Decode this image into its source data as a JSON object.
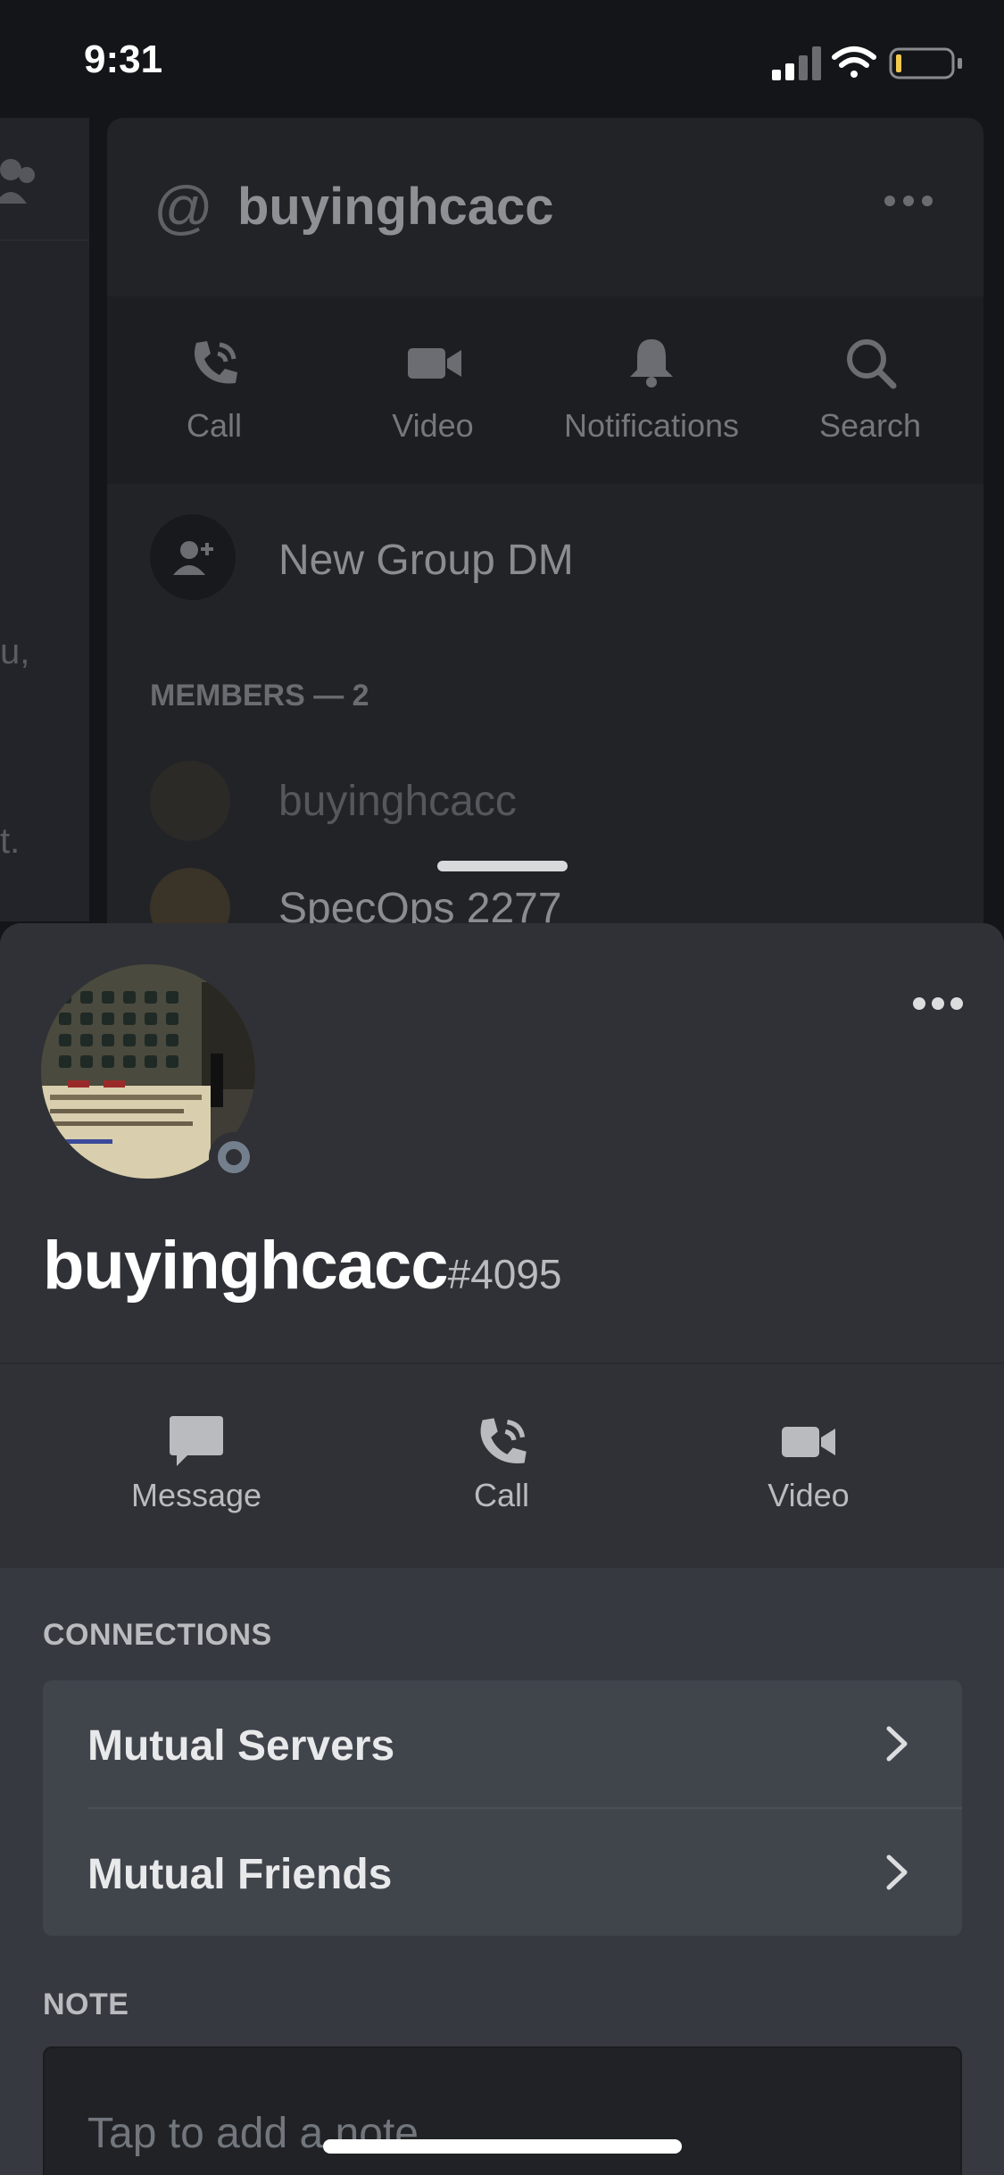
{
  "status_bar": {
    "time": "9:31",
    "battery_level": 0.1
  },
  "background": {
    "left_snippets": [
      "u,",
      "t."
    ],
    "dm_header": {
      "at_symbol": "@",
      "title": "buyinghcacc"
    },
    "actions": [
      {
        "label": "Call",
        "icon": "phone-icon"
      },
      {
        "label": "Video",
        "icon": "video-icon"
      },
      {
        "label": "Notifications",
        "icon": "bell-icon"
      },
      {
        "label": "Search",
        "icon": "search-icon"
      }
    ],
    "new_group_label": "New Group DM",
    "members_header": "MEMBERS — 2",
    "members": [
      "buyinghcacc",
      "SpecOps 2277"
    ]
  },
  "profile": {
    "username": "buyinghcacc",
    "discriminator": "#4095",
    "status": "offline",
    "actions": [
      {
        "label": "Message",
        "icon": "message-icon"
      },
      {
        "label": "Call",
        "icon": "phone-icon"
      },
      {
        "label": "Video",
        "icon": "video-icon"
      }
    ],
    "connections_label": "CONNECTIONS",
    "connections": [
      {
        "label": "Mutual Servers"
      },
      {
        "label": "Mutual Friends"
      }
    ],
    "note_label": "NOTE",
    "note_placeholder": "Tap to add a note"
  },
  "colors": {
    "sheet_bg": "#36393f",
    "offline_status": "#747f8d",
    "card_bg": "#40444b"
  }
}
